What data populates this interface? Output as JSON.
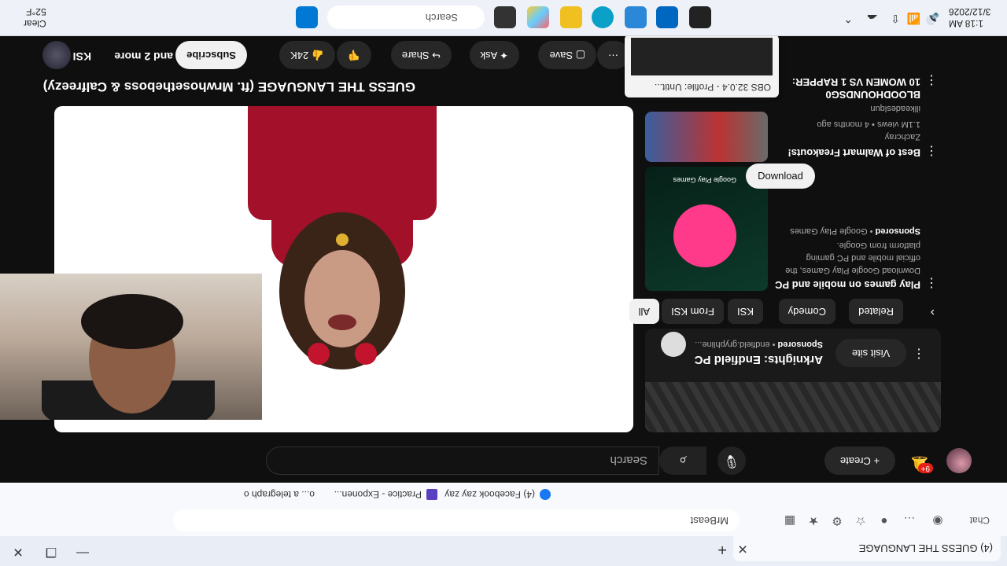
{
  "browser": {
    "tab_title": "(4) GUESS THE LANGUAGE",
    "address": "MrBeast",
    "bookmarks": [
      "(4) Facebook zay zay",
      "Practice - Exponen...",
      "o... a telegraph o"
    ],
    "profile_label": "Chat"
  },
  "youtube": {
    "search_placeholder": "Search",
    "create_label": "Create",
    "notif_count": "9+",
    "video_title": "GUESS THE LANGUAGE (ft. Mrwhosetheboss & Calfreezy)",
    "channel": "KSI",
    "channel_more": "and 2 more",
    "subscribe": "Subscribe",
    "likes": "24K",
    "share": "Share",
    "ask": "Ask",
    "save": "Save"
  },
  "sidebar": {
    "ad": {
      "title": "Arknights: Endfield PC",
      "sponsor": "Sponsored",
      "domain": "endfield.gryphline...",
      "visit": "Visit site"
    },
    "chips": [
      "All",
      "From KSI",
      "KSI",
      "Comedy",
      "Related"
    ],
    "items": [
      {
        "title": "Play games on mobile and PC",
        "desc1": "Download Google Play Games, the",
        "desc2": "official mobile and PC gaming",
        "desc3": "platform from Google.",
        "sponsor": "Sponsored",
        "advertiser": "Google Play Games",
        "button": "Download",
        "thumb_label": "Google Play Games"
      },
      {
        "title": "Best of Walmart Freakouts!",
        "channel": "Zachcray",
        "meta": "1.1M views • 4 months ago"
      },
      {
        "title": "10 WOMEN VS 1 RAPPER:",
        "channel": "BLOODHOUNDSG0",
        "meta": "illkeadeslqun"
      }
    ]
  },
  "taskbar": {
    "search": "Search",
    "time": "1:18 AM",
    "date": "3/12/2026",
    "weather_temp": "52°F",
    "weather_desc": "Clear"
  },
  "preview": {
    "title": "OBS 32.0.4 - Profile: Untit..."
  }
}
